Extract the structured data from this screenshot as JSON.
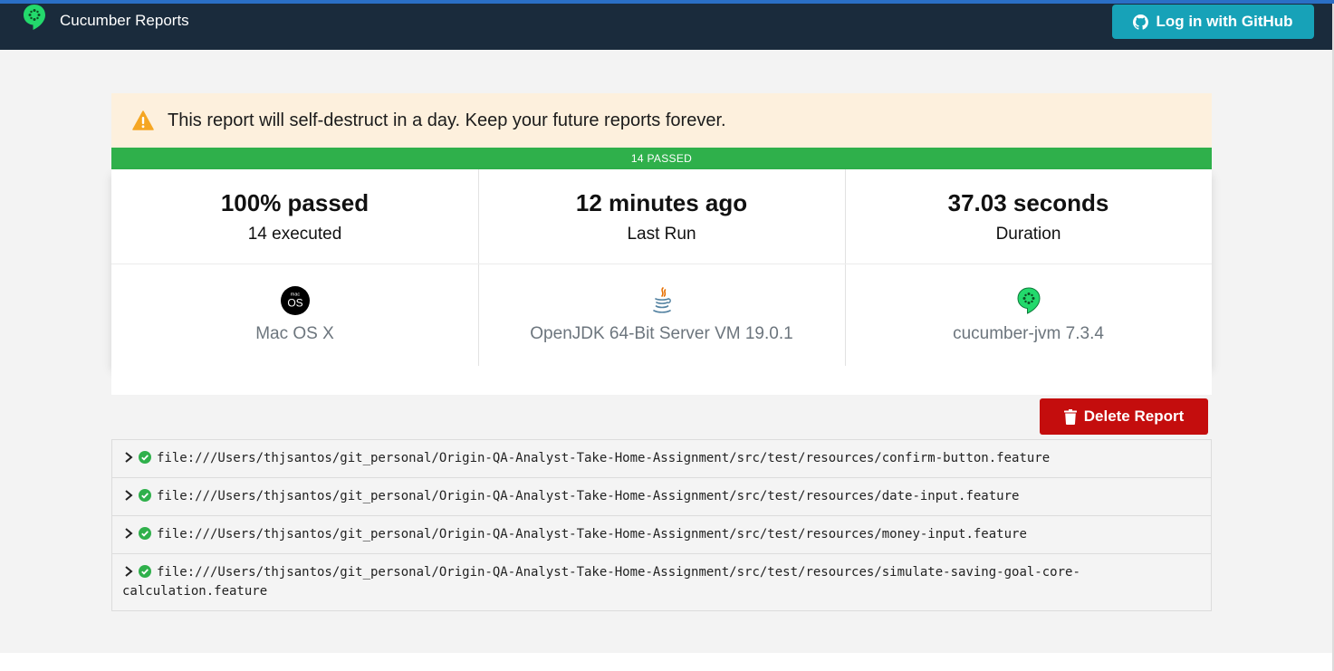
{
  "app": {
    "brand": "Cucumber Reports",
    "login_button": "Log in with GitHub"
  },
  "alert": {
    "icon": "warning-icon",
    "text": "This report will self-destruct in a day. Keep your future reports forever."
  },
  "status_bar": {
    "text": "14 PASSED",
    "color": "#2fb04b"
  },
  "stats": [
    {
      "value": "100% passed",
      "label": "14 executed"
    },
    {
      "value": "12 minutes ago",
      "label": "Last Run"
    },
    {
      "value": "37.03 seconds",
      "label": "Duration"
    }
  ],
  "environment": [
    {
      "icon": "macos-icon",
      "label": "Mac OS X"
    },
    {
      "icon": "java-icon",
      "label": "OpenJDK 64-Bit Server VM 19.0.1"
    },
    {
      "icon": "cucumber-icon",
      "label": "cucumber-jvm 7.3.4"
    }
  ],
  "delete_button": "Delete Report",
  "features": [
    {
      "path": "file:///Users/thjsantos/git_personal/Origin-QA-Analyst-Take-Home-Assignment/src/test/resources/confirm-button.feature",
      "status": "passed"
    },
    {
      "path": "file:///Users/thjsantos/git_personal/Origin-QA-Analyst-Take-Home-Assignment/src/test/resources/date-input.feature",
      "status": "passed"
    },
    {
      "path": "file:///Users/thjsantos/git_personal/Origin-QA-Analyst-Take-Home-Assignment/src/test/resources/money-input.feature",
      "status": "passed"
    },
    {
      "path": "file:///Users/thjsantos/git_personal/Origin-QA-Analyst-Take-Home-Assignment/src/test/resources/simulate-saving-goal-core-calculation.feature",
      "status": "passed"
    }
  ],
  "colors": {
    "navbar": "#1a2b3c",
    "accent": "#17a2b8",
    "danger": "#c40d0d",
    "success": "#2fb04b",
    "alert_bg": "#fdf0dd"
  }
}
